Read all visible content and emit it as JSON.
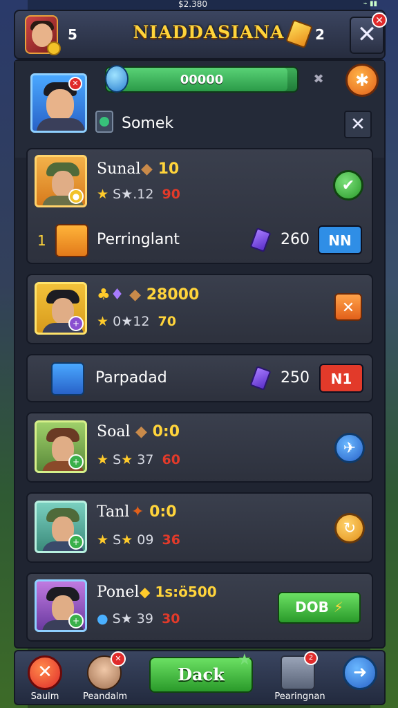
{
  "status": {
    "time": "$2.380"
  },
  "header": {
    "player_count": "5",
    "title": "NIADDASIANA",
    "gem_count": "2",
    "close_label": "✕"
  },
  "profile": {
    "progress_text": "00000",
    "progress_fraction": 0.95,
    "search_label": "Somek"
  },
  "cards": [
    {
      "name": "Sunal",
      "resource": "10",
      "meta_a": "S",
      "meta_b": "12",
      "meta_red": "90"
    },
    {
      "name": "",
      "resource": "28000",
      "meta_a": "0",
      "meta_b": "12",
      "meta_red": "70"
    },
    {
      "name": "Soal",
      "resource": "0:0",
      "meta_a": "S",
      "meta_b": "37",
      "meta_red": "60"
    },
    {
      "name": "Tanl",
      "resource": "0:0",
      "meta_a": "S",
      "meta_b": "09",
      "meta_red": "36"
    },
    {
      "name": "Ponel",
      "resource": "1s:ö500",
      "meta_a": "S",
      "meta_b": "39",
      "meta_red": "30"
    }
  ],
  "rows": [
    {
      "prefix": "1",
      "label": "Perringlant",
      "price": "260",
      "button": "NN",
      "button_color": "#2f8ee6"
    },
    {
      "prefix": "",
      "label": "Parpadad",
      "price": "250",
      "button": "N1",
      "button_color": "#e23a2a"
    }
  ],
  "last_card_button": "DOB",
  "bottom": {
    "left_label": "Saulm",
    "avatar_label": "Peandalm",
    "dock_label": "Dack",
    "right_label": "Pearingnan"
  },
  "colors": {
    "accent": "#ffd43b",
    "green": "#2a9a2a",
    "red": "#e23a2a",
    "blue": "#2f8ee6",
    "orange": "#f08a24"
  }
}
